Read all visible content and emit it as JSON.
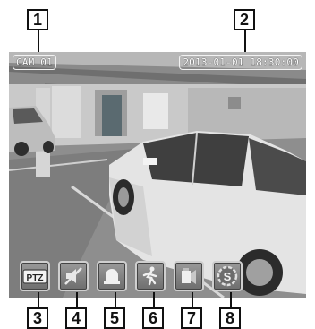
{
  "callouts": {
    "top": [
      "1",
      "2"
    ],
    "bottom": [
      "3",
      "4",
      "5",
      "6",
      "7",
      "8"
    ]
  },
  "overlay": {
    "camera_name": "CAM 01",
    "datetime": "2013-01-01 18:30:00"
  },
  "status_icons": [
    {
      "icon": "ptz-icon",
      "label": "PTZ"
    },
    {
      "icon": "audio-mute-icon"
    },
    {
      "icon": "alarm-icon"
    },
    {
      "icon": "motion-detection-icon"
    },
    {
      "icon": "video-loss-icon"
    },
    {
      "icon": "sequence-icon",
      "label": "S"
    }
  ],
  "colors": {
    "overlay_text": "#ffffff",
    "icon_frame": "#cfcfcf"
  }
}
